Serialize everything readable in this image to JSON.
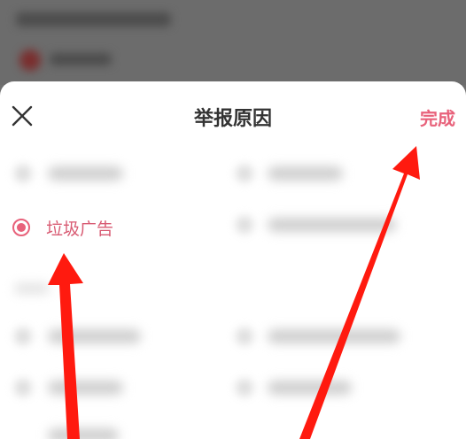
{
  "header": {
    "title": "举报原因",
    "done_label": "完成",
    "close_icon": "close-icon"
  },
  "selected_option": {
    "label": "垃圾广告",
    "selected": true
  },
  "colors": {
    "accent": "#e8627b",
    "arrow": "#ff1a0f",
    "title_text": "#333333",
    "overlay": "#6c6c6c"
  }
}
